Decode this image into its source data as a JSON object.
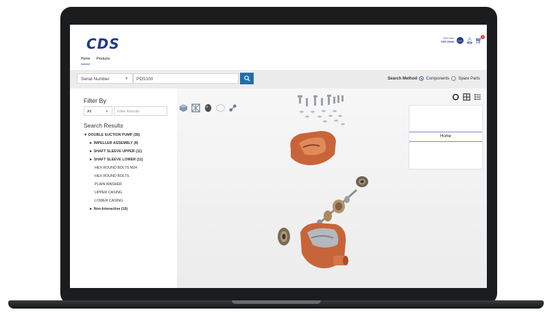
{
  "brand": {
    "logo_text": "CDS"
  },
  "nav": {
    "items": [
      "Home",
      "Products"
    ],
    "active": "Home"
  },
  "user": {
    "name": "CDS User",
    "company": "CDS Visual",
    "initials": "CU",
    "cart_count": "0"
  },
  "search": {
    "type_label": "Serial Number",
    "value": "PDS100",
    "method_label": "Search Method",
    "options": [
      "Components",
      "Spare Parts"
    ],
    "selected": "Components"
  },
  "filter": {
    "title": "Filter By",
    "scope": "All",
    "placeholder": "Filter Results"
  },
  "results": {
    "title": "Search Results",
    "root": "DOUBLE SUCTION PUMP  (38)",
    "groups": [
      "IMPELLER ASSEMBLY  (8)",
      "SHAFT SLEEVE UPPER  (11)",
      "SHAFT SLEEVE LOWER  (11)"
    ],
    "parts": [
      "HEX ROUND BOLTS M24",
      "HEX ROUND BOLTS",
      "PLAIN WASHER",
      "UPPER CASING",
      "LOWER CASING"
    ],
    "noninteractive": "Non-Interactive  (16)"
  },
  "viewer": {
    "panel_tab": "Home",
    "tools": [
      "cube-icon",
      "wireframe-icon",
      "shaded-icon",
      "transparent-icon",
      "explode-icon"
    ],
    "views": [
      "3d-view-icon",
      "grid-view-icon",
      "list-view-icon"
    ]
  },
  "colors": {
    "accent": "#1f6fad",
    "brand": "#1e3a8a",
    "part_orange": "#c8643a"
  }
}
